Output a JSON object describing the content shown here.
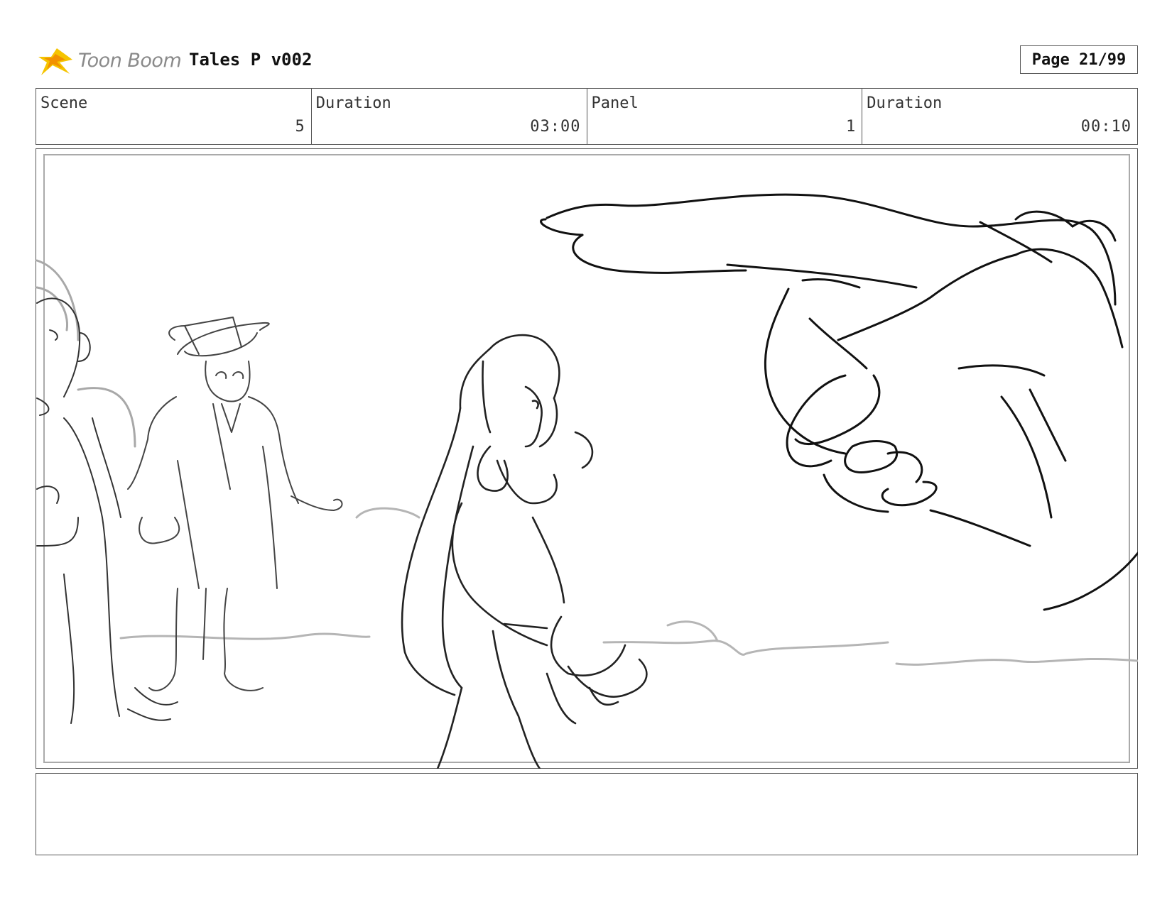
{
  "header": {
    "logo_text": "Toon Boom",
    "title": "Tales P v002",
    "page": "Page 21/99"
  },
  "info": {
    "scene_label": "Scene",
    "scene_value": "5",
    "scene_duration_label": "Duration",
    "scene_duration_value": "03:00",
    "panel_label": "Panel",
    "panel_value": "1",
    "panel_duration_label": "Duration",
    "panel_duration_value": "00:10"
  },
  "notes": {
    "text": ""
  },
  "colors": {
    "logo_yellow": "#f5c400",
    "logo_orange": "#f29100",
    "border": "#555555"
  }
}
